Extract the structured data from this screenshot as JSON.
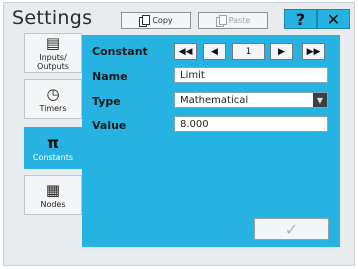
{
  "header": {
    "title": "Settings",
    "copy_label": "Copy",
    "paste_label": "Paste",
    "help_label": "?",
    "close_label": "✕"
  },
  "sidebar": {
    "items": [
      {
        "label": "Inputs/ Outputs",
        "icon": "io-icon"
      },
      {
        "label": "Timers",
        "icon": "clock-icon"
      },
      {
        "label": "Constants",
        "icon": "pi-icon",
        "active": true
      },
      {
        "label": "Nodes",
        "icon": "nodes-icon"
      }
    ]
  },
  "form": {
    "constant_label": "Constant",
    "constant_index": "1",
    "nav": {
      "first": "◀◀",
      "prev": "◀",
      "next": "▶",
      "last": "▶▶"
    },
    "name_label": "Name",
    "name_value": "Limit",
    "type_label": "Type",
    "type_value": "Mathematical",
    "value_label": "Value",
    "value_value": "8.000"
  },
  "ok_symbol": "✓",
  "colors": {
    "accent": "#27b3e1",
    "background": "#e9ecee"
  }
}
